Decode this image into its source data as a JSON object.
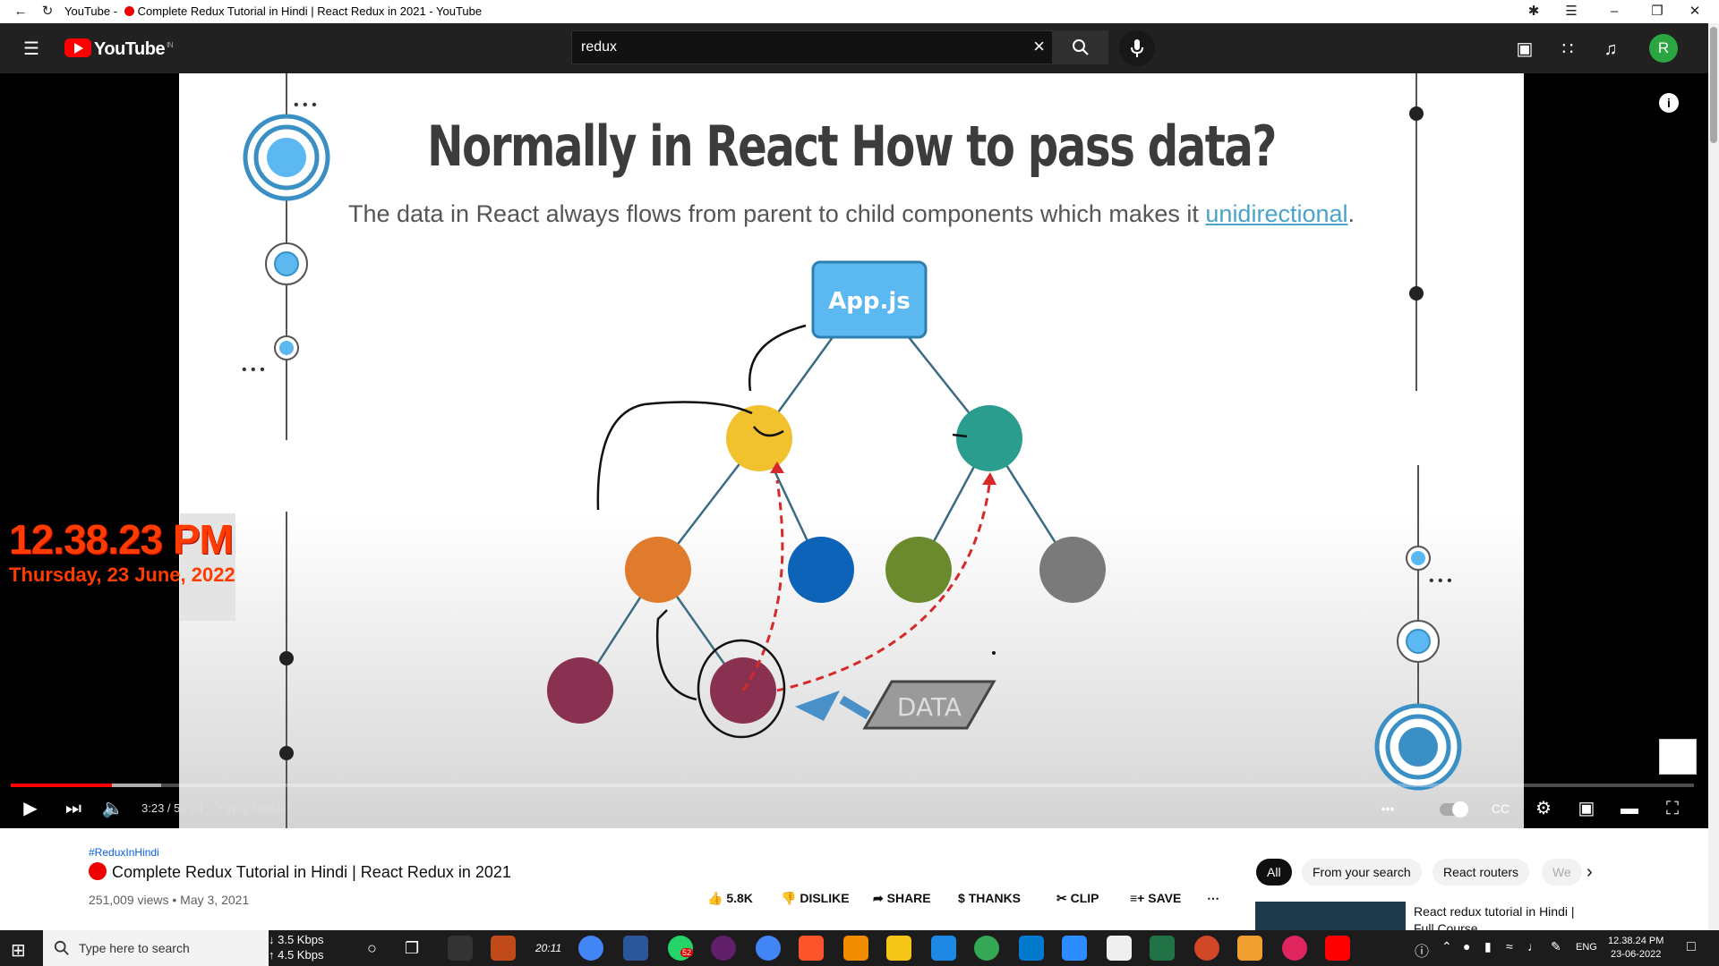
{
  "browser": {
    "title": "YouTube - ",
    "title_rest": "Complete Redux Tutorial in Hindi | React Redux in 2021 - YouTube"
  },
  "header": {
    "logo": "YouTube",
    "country": "IN",
    "search_value": "redux",
    "avatar_letter": "R"
  },
  "slide": {
    "title": "Normally in React How to pass data?",
    "subtitle_pre": "The data in React always flows from parent to child components which makes it ",
    "subtitle_highlight": "unidirectional",
    "subtitle_post": ".",
    "root_label": "App.js",
    "data_label": "DATA",
    "dots": "• • •"
  },
  "overlay": {
    "time": "12.38.23 PM",
    "date": "Thursday, 23 June, 2022"
  },
  "player": {
    "current_time": "3:23",
    "duration": "56:24",
    "time_display": "3:23 / 56:24",
    "chapter": "• Why Redux",
    "progress_fraction": 0.06
  },
  "video": {
    "hashtag": "#ReduxInHindi",
    "title": "Complete Redux Tutorial in Hindi | React Redux in 2021",
    "views": "251,009 views • May 3, 2021",
    "likes": "5.8K",
    "dislike": "DISLIKE",
    "share": "SHARE",
    "thanks": "THANKS",
    "clip": "CLIP",
    "save": "SAVE"
  },
  "chips": [
    "All",
    "From your search",
    "React routers",
    "We"
  ],
  "recommendation": {
    "title": "React redux tutorial in Hindi | Full Course"
  },
  "taskbar": {
    "search_placeholder": "Type here to search",
    "net_down": "3.5 Kbps",
    "net_up": "4.5 Kbps",
    "clock_app": "20:11",
    "badge": "52",
    "lang": "ENG",
    "time": "12.38.24 PM",
    "date": "23-06-2022"
  }
}
